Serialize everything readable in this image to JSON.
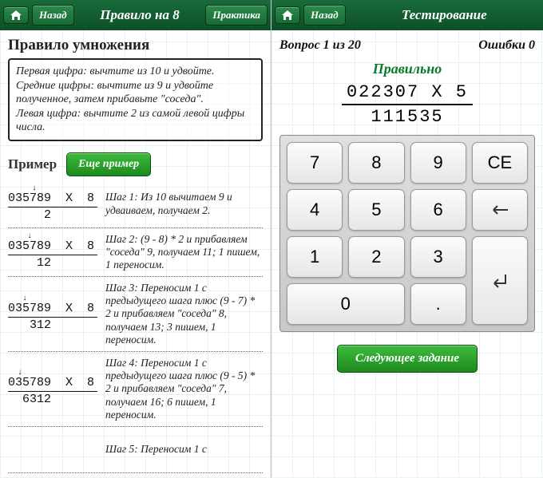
{
  "left": {
    "header": {
      "back": "Назад",
      "title": "Правило на 8",
      "practice": "Практика"
    },
    "h1": "Правило умножения",
    "rule": "Первая цифра: вычтите из 10 и удвойте.\nСредние цифры: вычтите из 9 и удвойте полученное, затем прибавьте \"соседа\".\nЛевая цифра: вычтите 2 из самой левой цифры числа.",
    "example_label": "Пример",
    "more": "Еще пример",
    "steps": [
      {
        "top": "035789  X  8",
        "arrow": "     ↓",
        "res": "     2",
        "text": "Шаг 1: Из 10 вычитаем 9 и удваиваем, получаем 2."
      },
      {
        "top": "035789  X  8",
        "arrow": "    ↓",
        "res": "    12",
        "text": "Шаг 2: (9 - 8) * 2 и прибавляем \"соседа\" 9, получаем 11; 1 пишем, 1 переносим."
      },
      {
        "top": "035789  X  8",
        "arrow": "   ↓",
        "res": "   312",
        "text": "Шаг 3: Переносим 1 с предыдущего шага плюс (9 - 7) * 2 и прибавляем \"соседа\" 8, получаем 13; 3 пишем, 1 переносим."
      },
      {
        "top": "035789  X  8",
        "arrow": "  ↓",
        "res": "  6312",
        "text": "Шаг 4: Переносим 1 с предыдущего шага плюс (9 - 5) * 2 и прибавляем \"соседа\" 7, получаем 16; 6 пишем, 1 переносим."
      },
      {
        "top": "",
        "arrow": "",
        "res": "",
        "text": "Шаг 5: Переносим 1 с"
      }
    ]
  },
  "right": {
    "header": {
      "back": "Назад",
      "title": "Тестирование"
    },
    "question": "Вопрос 1 из 20",
    "errors": "Ошибки 0",
    "correct": "Правильно",
    "problem_top": "022307  X  5",
    "problem_res": "111535",
    "keys": {
      "k7": "7",
      "k8": "8",
      "k9": "9",
      "ce": "CE",
      "k4": "4",
      "k5": "5",
      "k6": "6",
      "back": "←",
      "k1": "1",
      "k2": "2",
      "k3": "3",
      "enter": "↵",
      "k0": "0",
      "dot": "."
    },
    "next": "Следующее задание"
  }
}
